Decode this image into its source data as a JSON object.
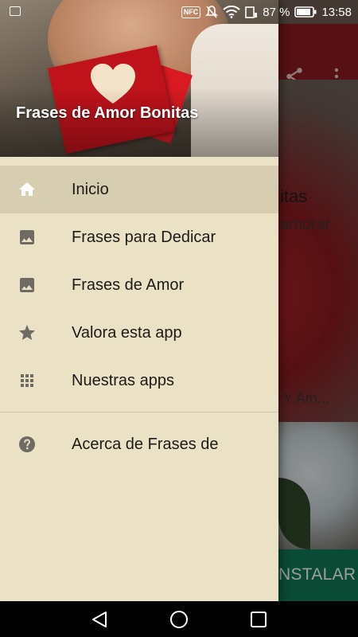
{
  "status_bar": {
    "battery_percent": "87 %",
    "time": "13:58",
    "nfc_label": "NFC"
  },
  "background_app": {
    "title_fragment": "itas",
    "subtitle_fragment": "amorar",
    "list_fragment": "Y Am...",
    "install_label": "NSTALAR"
  },
  "drawer": {
    "app_title": "Frases de Amor Bonitas",
    "items": [
      {
        "label": "Inicio",
        "icon": "home-icon",
        "selected": true
      },
      {
        "label": "Frases para Dedicar",
        "icon": "image-icon",
        "selected": false
      },
      {
        "label": "Frases de Amor",
        "icon": "image-icon",
        "selected": false
      },
      {
        "label": "Valora esta app",
        "icon": "star-icon",
        "selected": false
      },
      {
        "label": "Nuestras apps",
        "icon": "apps-grid-icon",
        "selected": false
      }
    ],
    "secondary_items": [
      {
        "label": "Acerca de Frases de",
        "icon": "help-icon"
      }
    ]
  },
  "colors": {
    "drawer_bg": "#ebe2c5",
    "selected_bg": "#d7ceb1",
    "toolbar": "#8d1a1f",
    "install_green": "#0f7a55",
    "icon_gray": "#6e6a64"
  }
}
